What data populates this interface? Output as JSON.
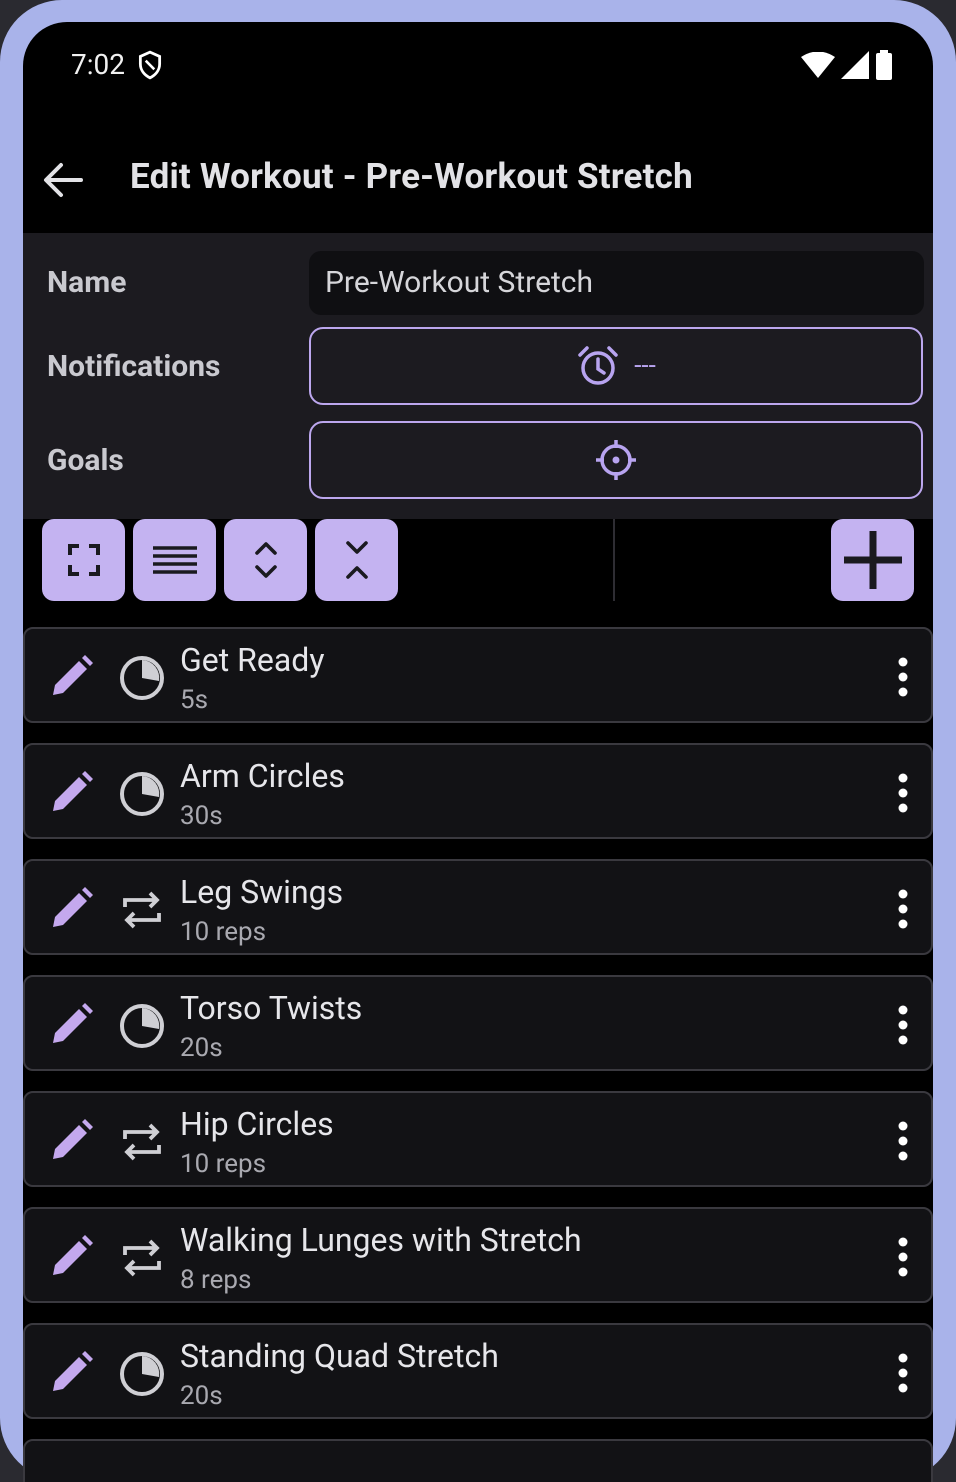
{
  "status_bar": {
    "time": "7:02"
  },
  "app_bar": {
    "title": "Edit Workout - Pre-Workout Stretch"
  },
  "fields": {
    "name_label": "Name",
    "name_value": "Pre-Workout Stretch",
    "notifications_label": "Notifications",
    "notifications_value": "---",
    "goals_label": "Goals"
  },
  "toolbar": {
    "buttons": [
      "expand-icon",
      "list-icon",
      "expand-vertical-icon",
      "collapse-vertical-icon"
    ],
    "add": "plus-icon"
  },
  "exercises": [
    {
      "name": "Get Ready",
      "detail": "5s",
      "type": "timer"
    },
    {
      "name": "Arm Circles",
      "detail": "30s",
      "type": "timer"
    },
    {
      "name": "Leg Swings",
      "detail": "10 reps",
      "type": "reps"
    },
    {
      "name": "Torso Twists",
      "detail": "20s",
      "type": "timer"
    },
    {
      "name": "Hip Circles",
      "detail": "10 reps",
      "type": "reps"
    },
    {
      "name": "Walking Lunges with Stretch",
      "detail": "8 reps",
      "type": "reps"
    },
    {
      "name": "Standing Quad Stretch",
      "detail": "20s",
      "type": "timer"
    }
  ],
  "colors": {
    "accent": "#c4b3f1",
    "outline": "#bca7ee",
    "frame": "#a9b3ea",
    "panel": "#1c1b20",
    "card": "#121215"
  }
}
